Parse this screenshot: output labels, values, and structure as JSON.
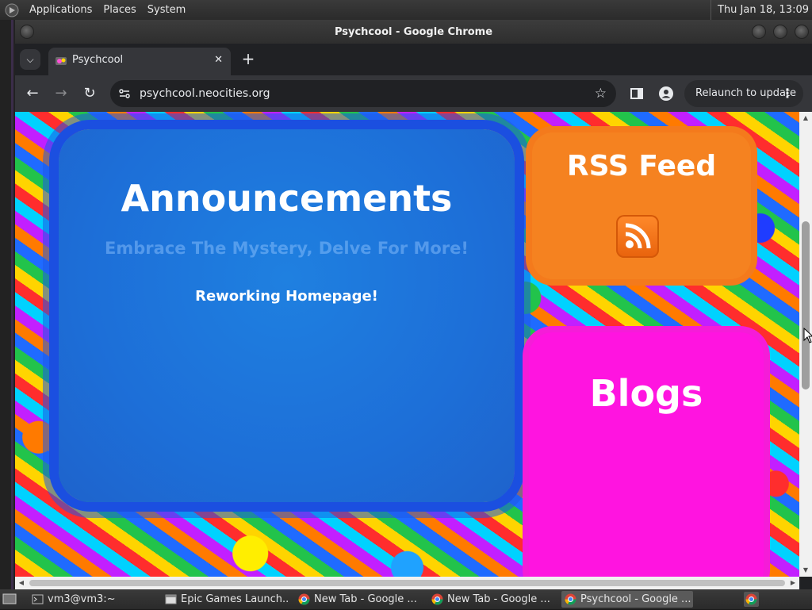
{
  "top_panel": {
    "menus": [
      "Applications",
      "Places",
      "System"
    ],
    "clock": "Thu Jan 18, 13:09"
  },
  "window": {
    "title": "Psychcool - Google Chrome"
  },
  "browser": {
    "tab_title": "Psychcool",
    "url": "psychcool.neocities.org",
    "relaunch_label": "Relaunch to update"
  },
  "page": {
    "announcements_title": "Announcements",
    "tagline": "Embrace The Mystery, Delve For More!",
    "announcement_item": "Reworking Homepage!",
    "rss_title": "RSS Feed",
    "blogs_title": "Blogs"
  },
  "taskbar": {
    "tasks": [
      {
        "label": "vm3@vm3:~",
        "icon": "terminal-icon"
      },
      {
        "label": "Epic Games Launch...",
        "icon": "window-icon"
      },
      {
        "label": "New Tab - Google ...",
        "icon": "chrome-icon"
      },
      {
        "label": "New Tab - Google ...",
        "icon": "chrome-icon"
      },
      {
        "label": "Psychcool - Google ...",
        "icon": "chrome-icon"
      }
    ]
  },
  "colors": {
    "announce_panel": "#1d6fd8",
    "rss_panel": "#f58220",
    "blogs_panel": "#ff14e0"
  }
}
